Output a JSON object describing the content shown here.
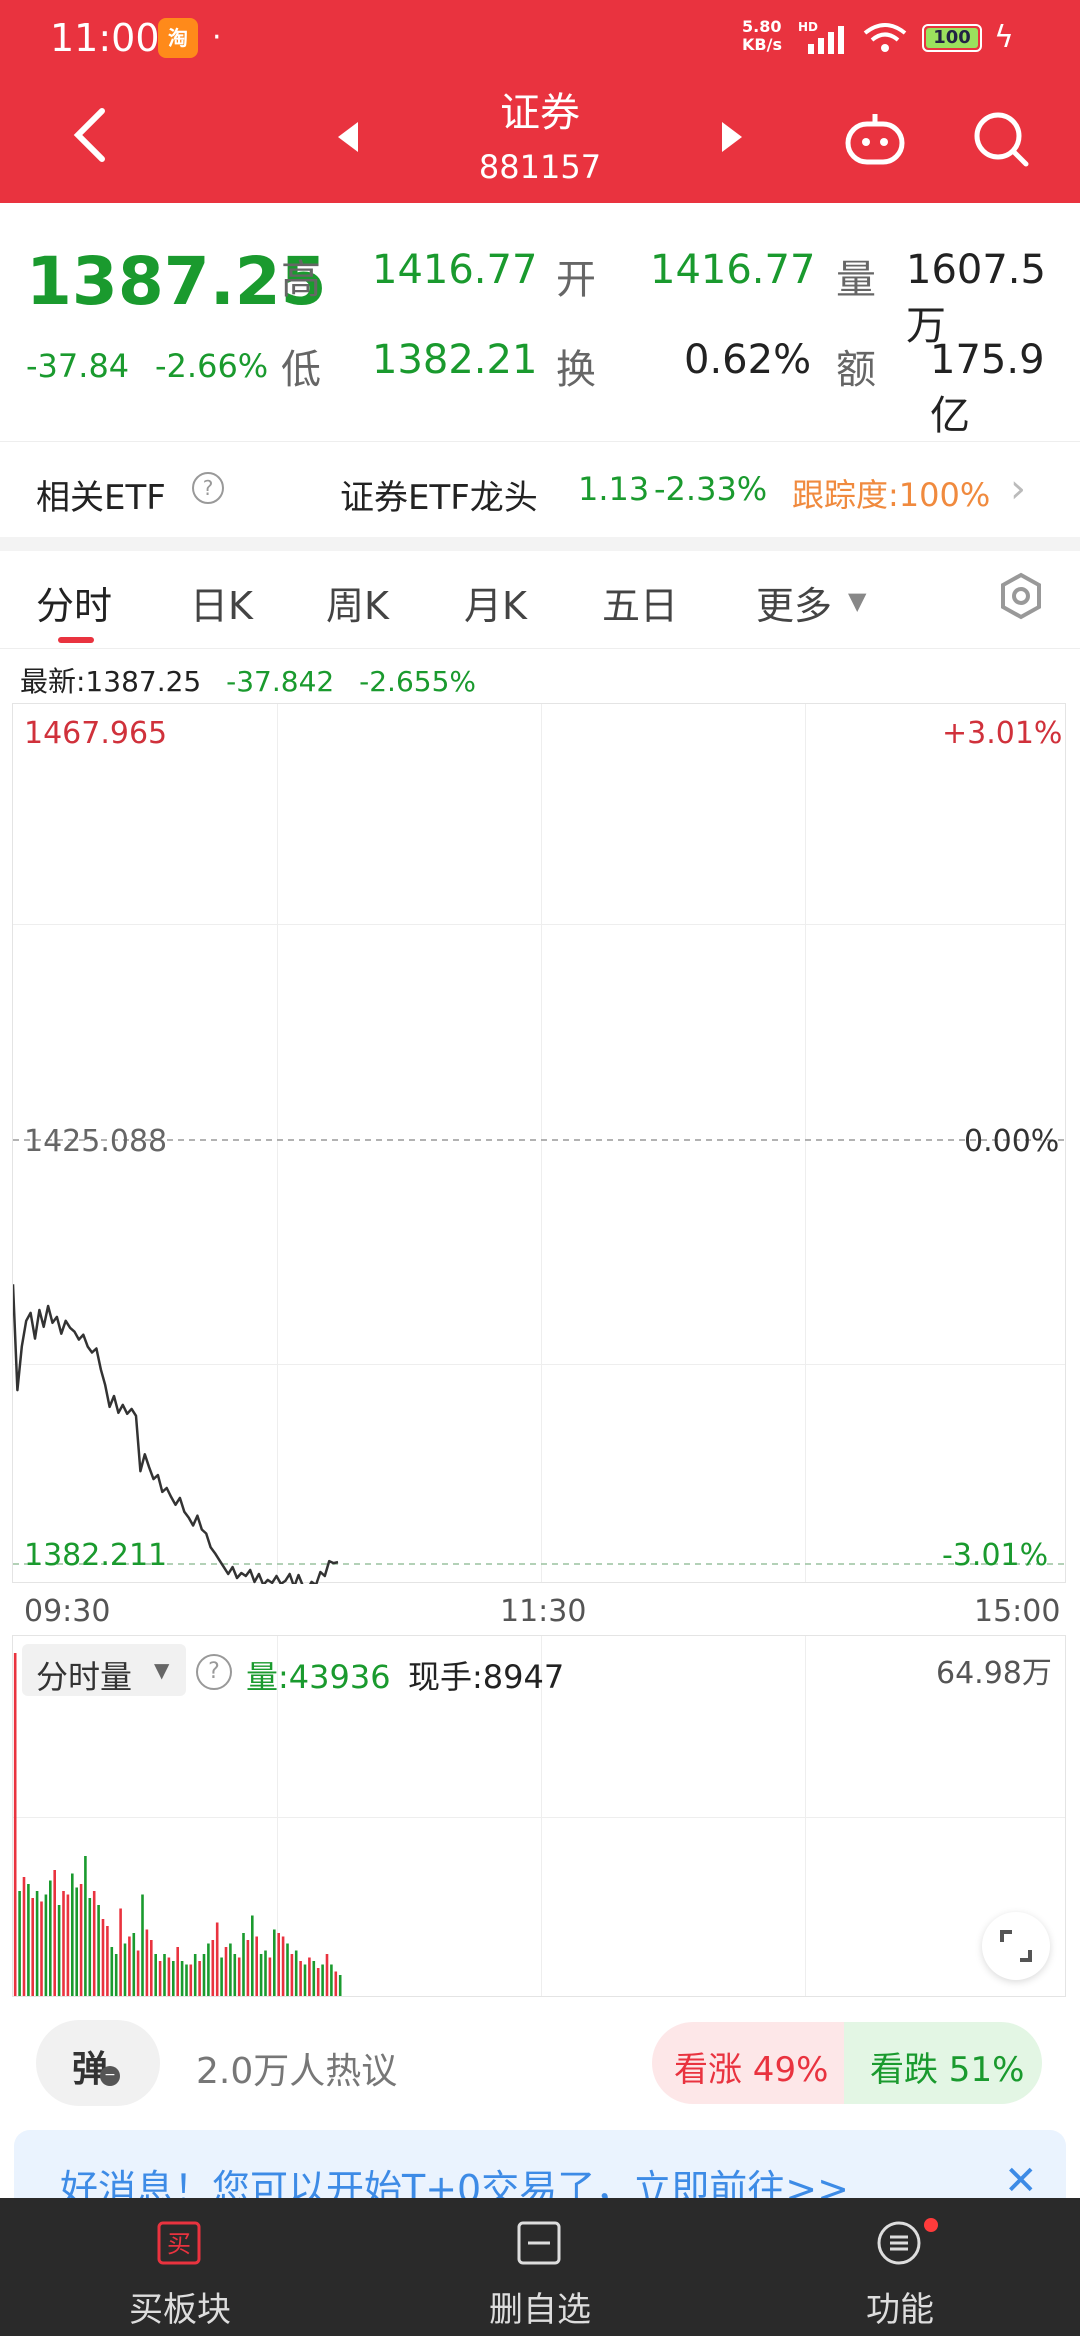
{
  "status_bar": {
    "time": "11:00",
    "app_badge": "淘",
    "dot": "·",
    "speed_value": "5.80",
    "speed_unit": "KB/s",
    "hd": "HD",
    "battery": "100"
  },
  "header": {
    "title": "证券",
    "code": "881157"
  },
  "quote": {
    "price": "1387.25",
    "change": "-37.84",
    "change_pct": "-2.66%",
    "high_label": "高",
    "high": "1416.77",
    "low_label": "低",
    "low": "1382.21",
    "open_label": "开",
    "open": "1416.77",
    "turnover_label": "换",
    "turnover": "0.62%",
    "volume_label": "量",
    "volume": "1607.5万",
    "amount_label": "额",
    "amount": "175.9亿"
  },
  "etf": {
    "label": "相关ETF",
    "help": "?",
    "name": "证券ETF龙头",
    "price": "1.13",
    "pct": "-2.33%",
    "tracking": "跟踪度:100%"
  },
  "tabs": [
    "分时",
    "日K",
    "周K",
    "月K",
    "五日",
    "更多"
  ],
  "latest": {
    "label": "最新:1387.25",
    "change": "-37.842",
    "pct": "-2.655%"
  },
  "chart_data": {
    "type": "line",
    "title": "",
    "x_ticks": [
      "09:30",
      "11:30",
      "15:00"
    ],
    "y_top_label": "1467.965",
    "y_top_pct": "+3.01%",
    "y_mid_label": "1425.088",
    "y_mid_pct": "0.00%",
    "y_bot_label": "1382.211",
    "y_bot_pct": "-3.01%",
    "ylim": [
      1382.211,
      1467.965
    ],
    "prev_close": 1425.088,
    "total_minutes": 240,
    "minutes": [
      0,
      1,
      2,
      3,
      4,
      5,
      6,
      7,
      8,
      9,
      10,
      11,
      12,
      13,
      14,
      15,
      16,
      17,
      18,
      19,
      20,
      21,
      22,
      23,
      24,
      25,
      26,
      27,
      28,
      29,
      30,
      31,
      32,
      33,
      34,
      35,
      36,
      37,
      38,
      39,
      40,
      41,
      42,
      43,
      44,
      45,
      46,
      47,
      48,
      49,
      50,
      51,
      52,
      53,
      54,
      55,
      56,
      57,
      58,
      59,
      60,
      61,
      62,
      63,
      64,
      65,
      66,
      67,
      68,
      69,
      70,
      71,
      72,
      73,
      74
    ],
    "prices": [
      1410.5,
      1399.8,
      1404.2,
      1406.8,
      1407.6,
      1405.0,
      1407.9,
      1406.2,
      1408.3,
      1406.6,
      1407.2,
      1405.5,
      1406.8,
      1406.1,
      1405.7,
      1404.9,
      1405.4,
      1404.2,
      1403.6,
      1404.0,
      1401.9,
      1400.3,
      1398.1,
      1399.2,
      1397.5,
      1398.3,
      1397.4,
      1397.9,
      1397.2,
      1391.6,
      1393.3,
      1392.0,
      1390.8,
      1391.2,
      1389.5,
      1389.9,
      1389.0,
      1388.2,
      1388.9,
      1387.5,
      1386.9,
      1386.1,
      1387.1,
      1385.7,
      1385.3,
      1383.9,
      1383.3,
      1382.6,
      1381.9,
      1381.2,
      1381.9,
      1380.8,
      1381.3,
      1381.0,
      1381.6,
      1380.4,
      1381.2,
      1380.1,
      1380.6,
      1380.3,
      1381.0,
      1380.2,
      1380.5,
      1381.2,
      1379.9,
      1381.1,
      1380.0,
      1379.6,
      1380.4,
      1380.1,
      1381.4,
      1381.0,
      1382.5,
      1382.3,
      1382.4
    ],
    "volume_label": "分时量",
    "volume_max_label": "64.98万",
    "volume_stat": "量:43936",
    "volume_hand": "现手:8947",
    "volumes": [
      0.98,
      0.3,
      0.34,
      0.32,
      0.28,
      0.3,
      0.27,
      0.29,
      0.33,
      0.36,
      0.26,
      0.3,
      0.29,
      0.35,
      0.31,
      0.32,
      0.4,
      0.28,
      0.3,
      0.26,
      0.22,
      0.2,
      0.14,
      0.12,
      0.25,
      0.15,
      0.17,
      0.18,
      0.13,
      0.29,
      0.19,
      0.16,
      0.12,
      0.1,
      0.12,
      0.11,
      0.1,
      0.14,
      0.1,
      0.09,
      0.09,
      0.12,
      0.1,
      0.12,
      0.15,
      0.16,
      0.21,
      0.11,
      0.14,
      0.15,
      0.12,
      0.11,
      0.18,
      0.16,
      0.23,
      0.17,
      0.12,
      0.13,
      0.11,
      0.19,
      0.18,
      0.17,
      0.15,
      0.12,
      0.13,
      0.1,
      0.09,
      0.11,
      0.1,
      0.08,
      0.09,
      0.12,
      0.09,
      0.07,
      0.06
    ],
    "volume_up": [
      true,
      false,
      true,
      false,
      true,
      false,
      true,
      false,
      false,
      true,
      false,
      true,
      true,
      false,
      false,
      true,
      false,
      false,
      true,
      false,
      true,
      true,
      false,
      false,
      true,
      false,
      true,
      false,
      true,
      false,
      true,
      true,
      false,
      true,
      false,
      true,
      false,
      true,
      false,
      false,
      true,
      false,
      true,
      false,
      false,
      true,
      true,
      false,
      true,
      false,
      false,
      true,
      false,
      true,
      false,
      true,
      false,
      false,
      true,
      false,
      true,
      true,
      false,
      true,
      false,
      true,
      false,
      true,
      false,
      true,
      false,
      true,
      false,
      true,
      false
    ],
    "colors": {
      "line": "#333333",
      "up": "#e9333f",
      "down": "#1a9a2e"
    }
  },
  "sentiment": {
    "danmu": "弹",
    "heat": "2.0万人热议",
    "bull": "看涨 49%",
    "bear": "看跌 51%"
  },
  "banner": {
    "text": "好消息！您可以开始T+0交易了，立即前往>>"
  },
  "bottom_nav": {
    "buy": "买板块",
    "remove": "删自选",
    "func": "功能"
  },
  "icons": [
    "back-icon",
    "prev-arrow-icon",
    "next-arrow-icon",
    "robot-icon",
    "search-icon",
    "settings-icon",
    "help-icon",
    "expand-icon",
    "close-icon"
  ]
}
